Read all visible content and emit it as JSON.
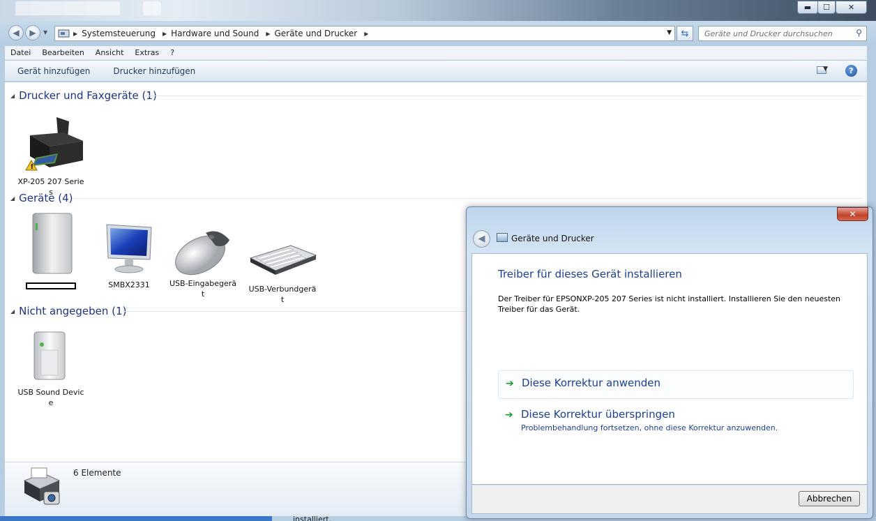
{
  "window": {
    "controls": {
      "minimize": "▬",
      "maximize": "☐",
      "close": "✕"
    }
  },
  "breadcrumb": {
    "items": [
      "Systemsteuerung",
      "Hardware und Sound",
      "Geräte und Drucker"
    ]
  },
  "search": {
    "placeholder": "Geräte und Drucker durchsuchen"
  },
  "menu": {
    "items": [
      "Datei",
      "Bearbeiten",
      "Ansicht",
      "Extras",
      "?"
    ]
  },
  "toolbar": {
    "add_device": "Gerät hinzufügen",
    "add_printer": "Drucker hinzufügen",
    "help": "?"
  },
  "groups": [
    {
      "title": "Drucker und Faxgeräte (1)",
      "devices": [
        {
          "label": "XP-205 207 Series",
          "icon": "printer-icon",
          "warning": true
        }
      ]
    },
    {
      "title": "Geräte (4)",
      "devices": [
        {
          "label": "",
          "icon": "computer-tower-icon"
        },
        {
          "label": "SMBX2331",
          "icon": "monitor-icon"
        },
        {
          "label": "USB-Eingabegerät",
          "icon": "mouse-icon"
        },
        {
          "label": "USB-Verbundgerät",
          "icon": "keyboard-icon"
        }
      ]
    },
    {
      "title": "Nicht angegeben (1)",
      "devices": [
        {
          "label": "USB Sound Device",
          "icon": "usb-device-icon"
        }
      ]
    }
  ],
  "status": {
    "count": "6 Elemente"
  },
  "background_text": "installiert.",
  "dialog": {
    "close": "✕",
    "title": "Geräte und Drucker",
    "heading": "Treiber für dieses Gerät installieren",
    "description": "Der Treiber für EPSONXP-205 207 Series ist nicht installiert. Installieren Sie den neuesten Treiber für das Gerät.",
    "option1": {
      "title": "Diese Korrektur anwenden"
    },
    "option2": {
      "title": "Diese Korrektur überspringen",
      "subtitle": "Problembehandlung fortsetzen, ohne diese Korrektur anzuwenden."
    },
    "cancel": "Abbrechen"
  }
}
